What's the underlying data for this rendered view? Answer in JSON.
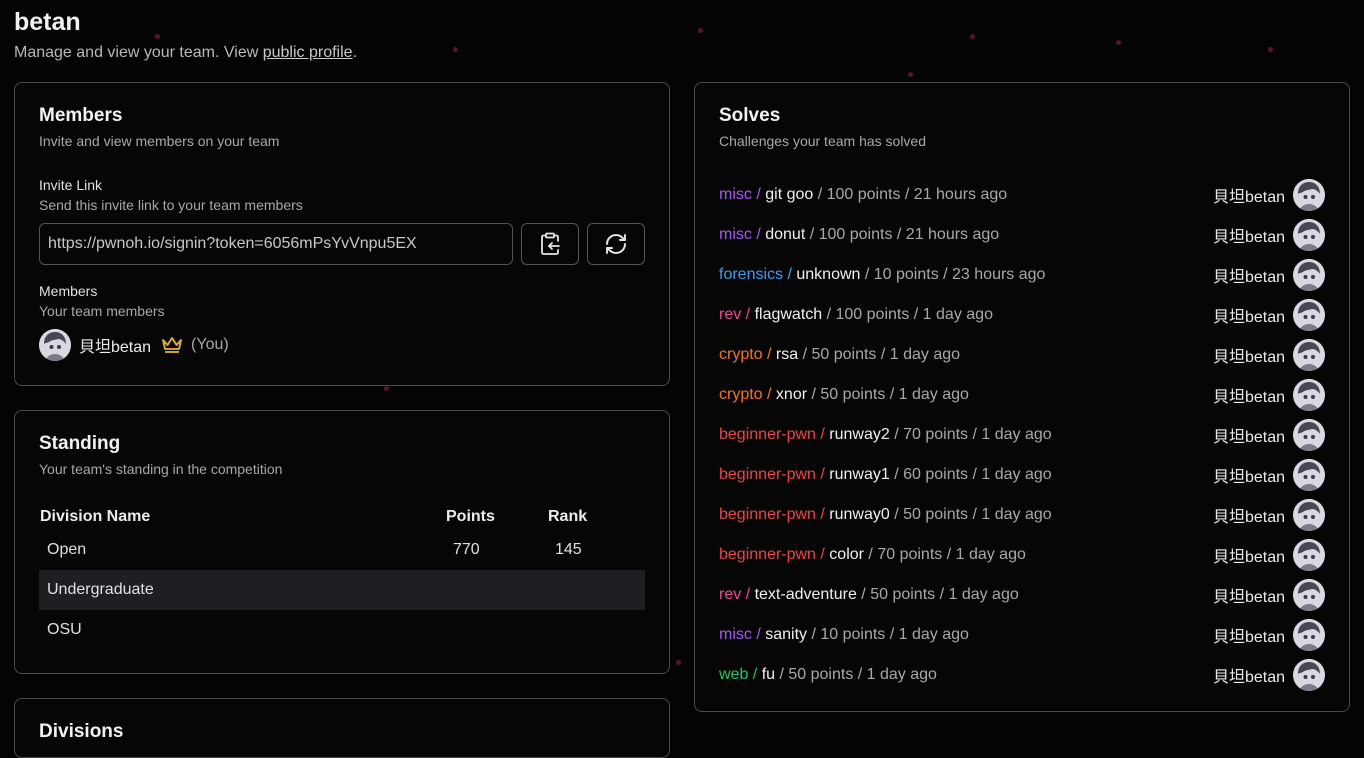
{
  "header": {
    "team_name": "betan",
    "subtitle_prefix": "Manage and view your team. View ",
    "public_profile_link": "public profile",
    "subtitle_suffix": "."
  },
  "members_card": {
    "title": "Members",
    "description": "Invite and view members on your team",
    "invite_label": "Invite Link",
    "invite_sublabel": "Send this invite link to your team members",
    "invite_url": "https://pwnoh.io/signin?token=6056mPsYvVnpu5EX",
    "members_label": "Members",
    "members_sublabel": "Your team members",
    "members": [
      {
        "name": "貝坦betan",
        "is_captain": true,
        "you_label": "(You)"
      }
    ],
    "icons": {
      "copy": "clipboard-copy-icon",
      "regenerate": "refresh-icon",
      "captain": "crown-icon"
    },
    "colors": {
      "crown": "#e6b422"
    }
  },
  "standing_card": {
    "title": "Standing",
    "description": "Your team's standing in the competition",
    "columns": [
      "Division Name",
      "Points",
      "Rank"
    ],
    "rows": [
      {
        "division": "Open",
        "points": "770",
        "rank": "145"
      },
      {
        "division": "Undergraduate",
        "points": "",
        "rank": ""
      },
      {
        "division": "OSU",
        "points": "",
        "rank": ""
      }
    ]
  },
  "divisions_card": {
    "title": "Divisions"
  },
  "solves_card": {
    "title": "Solves",
    "description": "Challenges your team has solved",
    "category_colors": {
      "misc": "#a855f7",
      "forensics": "#3b9ff0",
      "rev": "#ec4899",
      "crypto": "#f97316",
      "beginner-pwn": "#ef4444",
      "web": "#22c55e"
    },
    "solves": [
      {
        "category": "misc",
        "challenge": "git goo",
        "details": " / 100 points / 21 hours ago",
        "solver": "貝坦betan"
      },
      {
        "category": "misc",
        "challenge": "donut",
        "details": " / 100 points / 21 hours ago",
        "solver": "貝坦betan"
      },
      {
        "category": "forensics",
        "challenge": "unknown",
        "details": " / 10 points / 23 hours ago",
        "solver": "貝坦betan"
      },
      {
        "category": "rev",
        "challenge": "flagwatch",
        "details": " / 100 points / 1 day ago",
        "solver": "貝坦betan"
      },
      {
        "category": "crypto",
        "challenge": "rsa",
        "details": " / 50 points / 1 day ago",
        "solver": "貝坦betan"
      },
      {
        "category": "crypto",
        "challenge": "xnor",
        "details": " / 50 points / 1 day ago",
        "solver": "貝坦betan"
      },
      {
        "category": "beginner-pwn",
        "challenge": "runway2",
        "details": " / 70 points / 1 day ago",
        "solver": "貝坦betan"
      },
      {
        "category": "beginner-pwn",
        "challenge": "runway1",
        "details": " / 60 points / 1 day ago",
        "solver": "貝坦betan"
      },
      {
        "category": "beginner-pwn",
        "challenge": "runway0",
        "details": " / 50 points / 1 day ago",
        "solver": "貝坦betan"
      },
      {
        "category": "beginner-pwn",
        "challenge": "color",
        "details": " / 70 points / 1 day ago",
        "solver": "貝坦betan"
      },
      {
        "category": "rev",
        "challenge": "text-adventure",
        "details": " / 50 points / 1 day ago",
        "solver": "貝坦betan"
      },
      {
        "category": "misc",
        "challenge": "sanity",
        "details": " / 10 points / 1 day ago",
        "solver": "貝坦betan"
      },
      {
        "category": "web",
        "challenge": "fu",
        "details": " / 50 points / 1 day ago",
        "solver": "貝坦betan"
      }
    ]
  }
}
